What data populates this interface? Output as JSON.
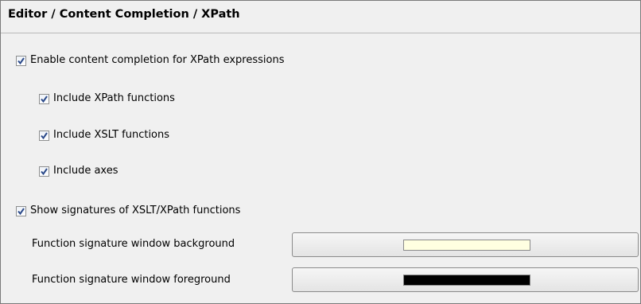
{
  "page": {
    "title": "Editor / Content Completion / XPath"
  },
  "options": {
    "enable_completion": {
      "label": "Enable content completion for XPath expressions",
      "checked": true
    },
    "include_xpath_functions": {
      "label": "Include XPath functions",
      "checked": true
    },
    "include_xslt_functions": {
      "label": "Include XSLT functions",
      "checked": true
    },
    "include_axes": {
      "label": "Include axes",
      "checked": true
    },
    "show_signatures": {
      "label": "Show signatures of XSLT/XPath functions",
      "checked": true
    }
  },
  "colors": {
    "background": {
      "label": "Function signature window background",
      "value": "#ffffe1"
    },
    "foreground": {
      "label": "Function signature window foreground",
      "value": "#000000"
    }
  },
  "theme": {
    "check_color": "#2b4a8a"
  }
}
